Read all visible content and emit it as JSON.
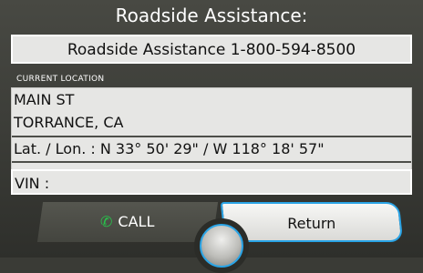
{
  "screen": {
    "title": "Roadside Assistance:",
    "phone": "Roadside Assistance 1-800-594-8500",
    "location_header": "CURRENT LOCATION",
    "address_line1": "MAIN ST",
    "address_line2": "TORRANCE, CA",
    "latlon": "Lat. / Lon. : N 33° 50' 29\" / W 118° 18' 57\"",
    "vin_label": "VIN :"
  },
  "buttons": {
    "call_label": "CALL",
    "return_label": "Return"
  },
  "icons": {
    "phone": "phone-icon",
    "knob": "selector-knob-icon"
  },
  "colors": {
    "accent": "#2aa4e6",
    "phone_icon": "#27c44b",
    "background": "#3a3b36",
    "field": "#e6e6e4"
  }
}
